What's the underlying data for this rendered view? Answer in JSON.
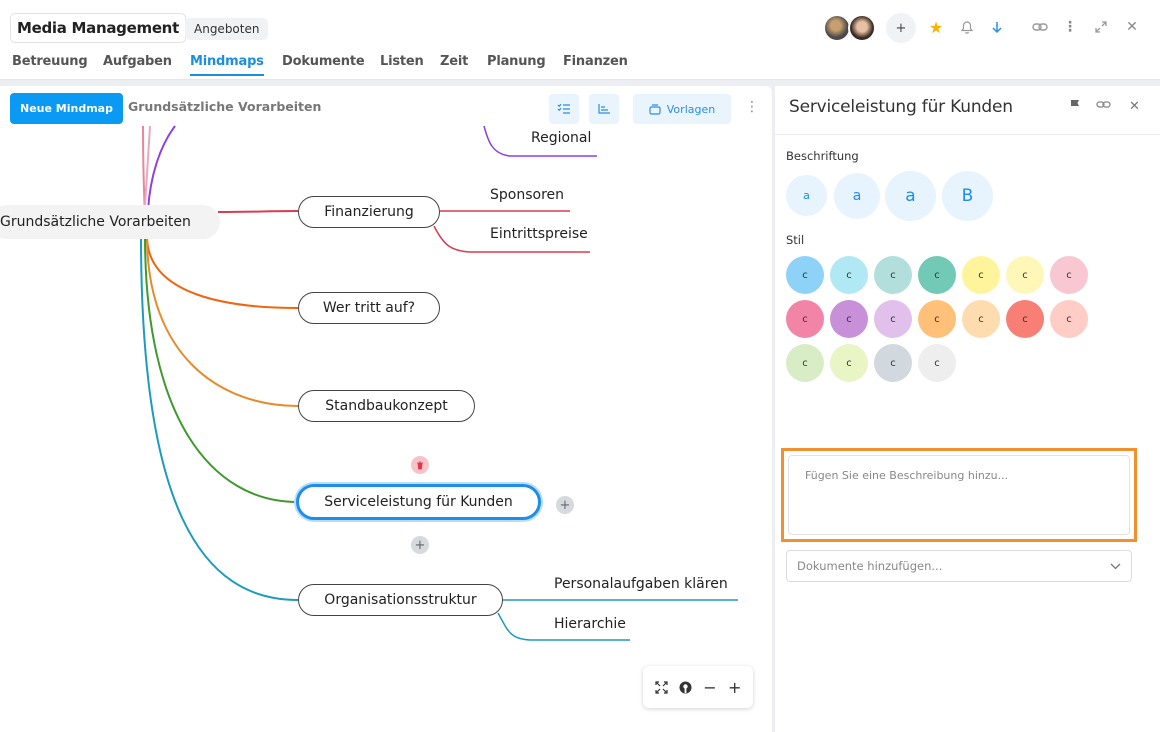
{
  "header": {
    "title": "Media Management",
    "status": "Angeboten",
    "tabs": [
      "Betreuung",
      "Aufgaben",
      "Mindmaps",
      "Dokumente",
      "Listen",
      "Zeit",
      "Planung",
      "Finanzen"
    ],
    "active_tab": "Mindmaps",
    "add_glyph": "+",
    "icons": [
      "star-icon",
      "bell-icon",
      "download-arrow-icon",
      "link-icon",
      "more-vertical-icon",
      "expand-icon",
      "close-icon"
    ]
  },
  "mindmap": {
    "new_button": "Neue Mindmap",
    "title": "Grundsätzliche Vorarbeiten",
    "templates_button": "Vorlagen",
    "root": "Grundsätzliche Vorarbeiten",
    "nodes": [
      "Finanzierung",
      "Wer tritt auf?",
      "Standbaukonzept",
      "Serviceleistung für Kunden",
      "Organisationsstruktur"
    ],
    "leaves": [
      "Regional",
      "Sponsoren",
      "Eintrittspreise",
      "Personalaufgaben klären",
      "Hierarchie"
    ],
    "add_glyph": "+",
    "zoom_minus": "−",
    "zoom_plus": "+"
  },
  "panel": {
    "title": "Serviceleistung für Kunden",
    "label_heading": "Beschriftung",
    "label_sizes": [
      "a",
      "a",
      "a",
      "B"
    ],
    "style_heading": "Stil",
    "swatch_letter": "c",
    "swatch_colors": [
      "#8ed2f8",
      "#b0e8f4",
      "#b2dfdb",
      "#72c9b6",
      "#fff49c",
      "#fff7b8",
      "#f9c7d2",
      "#f284a8",
      "#c890d9",
      "#e1c0ec",
      "#ffc17a",
      "#ffdcb0",
      "#f77f76",
      "#ffcdc6",
      "#d8edc6",
      "#e9f5c4",
      "#d1d9df",
      "#eeeeee"
    ],
    "desc_placeholder": "Fügen Sie eine Beschreibung hinzu...",
    "docs_placeholder": "Dokumente hinzufügen..."
  }
}
